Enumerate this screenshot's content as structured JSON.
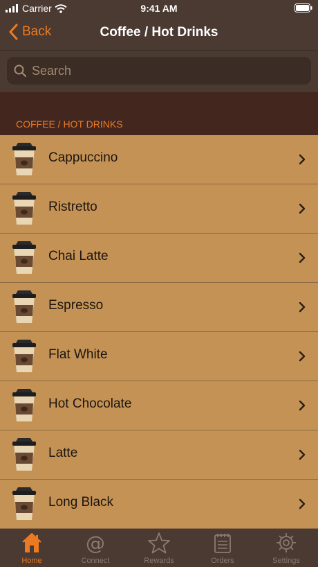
{
  "status_bar": {
    "carrier": "Carrier",
    "time": "9:41 AM"
  },
  "nav": {
    "back_label": "Back",
    "title": "Coffee / Hot Drinks"
  },
  "search": {
    "placeholder": "Search"
  },
  "section": {
    "header": "COFFEE / HOT DRINKS"
  },
  "items": [
    {
      "label": "Cappuccino"
    },
    {
      "label": "Ristretto"
    },
    {
      "label": "Chai Latte"
    },
    {
      "label": "Espresso"
    },
    {
      "label": "Flat White"
    },
    {
      "label": "Hot Chocolate"
    },
    {
      "label": "Latte"
    },
    {
      "label": "Long Black"
    }
  ],
  "tabs": [
    {
      "label": "Home",
      "icon": "home-icon",
      "active": true
    },
    {
      "label": "Connect",
      "icon": "at-icon",
      "active": false
    },
    {
      "label": "Rewards",
      "icon": "star-icon",
      "active": false
    },
    {
      "label": "Orders",
      "icon": "notepad-icon",
      "active": false
    },
    {
      "label": "Settings",
      "icon": "gear-icon",
      "active": false
    }
  ],
  "colors": {
    "accent": "#ec7a22",
    "list_bg": "#c49255",
    "nav_bg": "#4a3a32",
    "section_bg": "#43271f"
  }
}
